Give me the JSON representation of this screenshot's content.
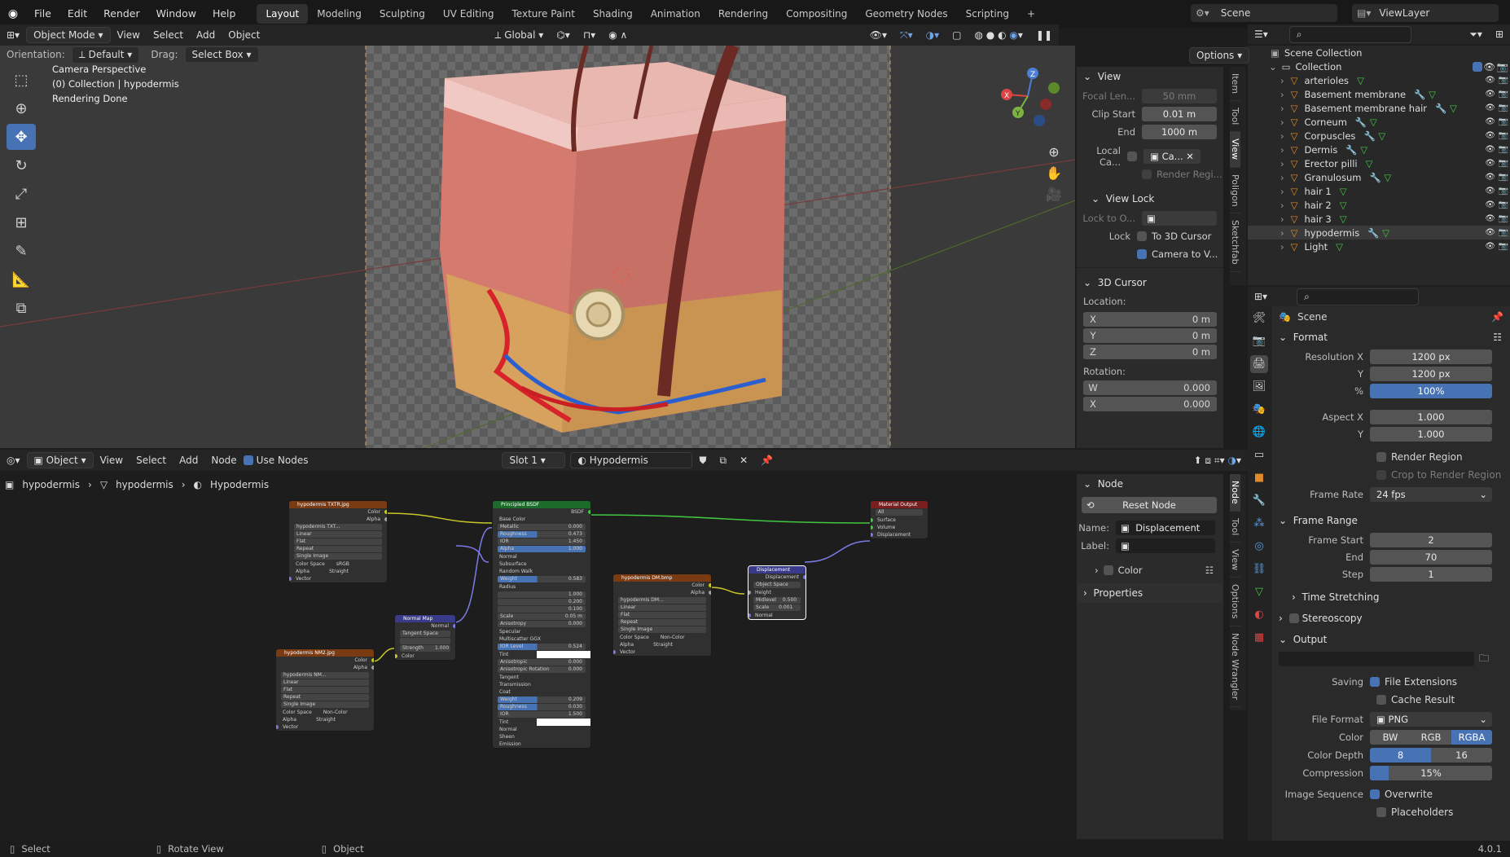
{
  "menu": [
    "File",
    "Edit",
    "Render",
    "Window",
    "Help"
  ],
  "workspaces": [
    "Layout",
    "Modeling",
    "Sculpting",
    "UV Editing",
    "Texture Paint",
    "Shading",
    "Animation",
    "Rendering",
    "Compositing",
    "Geometry Nodes",
    "Scripting",
    "+"
  ],
  "topright": {
    "scene": "Scene",
    "view_layer": "ViewLayer"
  },
  "viewport_header": {
    "mode": "Object Mode",
    "menus": [
      "View",
      "Select",
      "Add",
      "Object"
    ],
    "transform": "Global",
    "orientation_label": "Orientation:",
    "orientation": "Default",
    "drag_label": "Drag:",
    "drag": "Select Box",
    "options": "Options"
  },
  "viewport_overlay": {
    "line1": "Camera Perspective",
    "line2": "(0) Collection | hypodermis",
    "line3": "Rendering Done"
  },
  "npanel_view": {
    "section": "View",
    "focal_label": "Focal Len...",
    "focal": "50 mm",
    "clip_start_label": "Clip Start",
    "clip_start": "0.01 m",
    "clip_end_label": "End",
    "clip_end": "1000 m",
    "local_cam_label": "Local Ca...",
    "local_cam": "Ca...",
    "render_region": "Render Regi...",
    "view_lock": "View Lock",
    "lock_to_label": "Lock to O...",
    "lock_label": "Lock",
    "to_cursor": "To 3D Cursor",
    "cam_to_view": "Camera to V...",
    "cursor_section": "3D Cursor",
    "location_label": "Location:",
    "loc": [
      {
        "axis": "X",
        "val": "0 m"
      },
      {
        "axis": "Y",
        "val": "0 m"
      },
      {
        "axis": "Z",
        "val": "0 m"
      }
    ],
    "rotation_label": "Rotation:",
    "rot": [
      {
        "axis": "W",
        "val": "0.000"
      },
      {
        "axis": "X",
        "val": "0.000"
      }
    ]
  },
  "viewport_tabs": [
    "Item",
    "Tool",
    "View",
    "Poligon",
    "Sketchfab"
  ],
  "outliner": {
    "title": "Scene Collection",
    "collection": "Collection",
    "items": [
      "arterioles",
      "Basement membrane",
      "Basement membrane hair",
      "Corneum",
      "Corpuscles",
      "Dermis",
      "Erector pilli",
      "Granulosum",
      "hair 1",
      "hair 2",
      "hair 3",
      "hypodermis",
      "Light"
    ]
  },
  "node_header": {
    "mode": "Object",
    "menus": [
      "View",
      "Select",
      "Add",
      "Node"
    ],
    "use_nodes": "Use Nodes",
    "slot": "Slot 1",
    "material": "Hypodermis"
  },
  "breadcrumb": [
    "hypodermis",
    "hypodermis",
    "Hypodermis"
  ],
  "nodes": {
    "tex1": {
      "title": "hypodermis TXTR.jpg",
      "out1": "Color",
      "out2": "Alpha",
      "img": "hypodermis TXT...",
      "interp": "Linear",
      "proj": "Flat",
      "ext": "Repeat",
      "src": "Single Image",
      "cs_label": "Color Space",
      "cs": "sRGB",
      "alpha_label": "Alpha",
      "alpha": "Straight",
      "vec": "Vector"
    },
    "tex2": {
      "title": "hypodermis NM2.jpg",
      "out1": "Color",
      "out2": "Alpha",
      "img": "hypodermis NM...",
      "interp": "Linear",
      "proj": "Flat",
      "ext": "Repeat",
      "src": "Single Image",
      "cs_label": "Color Space",
      "cs": "Non-Color",
      "alpha_label": "Alpha",
      "alpha": "Straight",
      "vec": "Vector"
    },
    "nmap": {
      "title": "Normal Map",
      "out": "Normal",
      "space": "Tangent Space",
      "strength_label": "Strength",
      "strength": "1.000",
      "color": "Color"
    },
    "bsdf": {
      "title": "Principled BSDF",
      "out": "BSDF",
      "rows": [
        [
          "Base Color",
          ""
        ],
        [
          "Metallic",
          "0.000"
        ],
        [
          "Roughness",
          "0.473"
        ],
        [
          "IOR",
          "1.450"
        ],
        [
          "Alpha",
          "1.000"
        ],
        [
          "Normal",
          ""
        ],
        [
          "Subsurface",
          ""
        ],
        [
          "Random Walk",
          ""
        ],
        [
          "Weight",
          "0.583"
        ],
        [
          "Radius",
          ""
        ],
        [
          "",
          "1.000"
        ],
        [
          "",
          "0.200"
        ],
        [
          "",
          "0.100"
        ],
        [
          "Scale",
          "0.05 m"
        ],
        [
          "Anisotropy",
          "0.000"
        ],
        [
          "Specular",
          ""
        ],
        [
          "Multiscatter GGX",
          ""
        ],
        [
          "IOR Level",
          "0.524"
        ],
        [
          "Tint",
          ""
        ],
        [
          "Anisotropic",
          "0.000"
        ],
        [
          "Anisotropic Rotation",
          "0.000"
        ],
        [
          "Tangent",
          ""
        ],
        [
          "Transmission",
          ""
        ],
        [
          "Coat",
          ""
        ],
        [
          "Weight",
          "0.209"
        ],
        [
          "Roughness",
          "0.030"
        ],
        [
          "IOR",
          "1.500"
        ],
        [
          "Tint",
          ""
        ],
        [
          "Normal",
          ""
        ],
        [
          "Sheen",
          ""
        ],
        [
          "Emission",
          ""
        ]
      ]
    },
    "tex3": {
      "title": "hypodermis DM.bmp",
      "out1": "Color",
      "out2": "Alpha",
      "img": "hypodermis DM...",
      "interp": "Linear",
      "proj": "Flat",
      "ext": "Repeat",
      "src": "Single Image",
      "cs_label": "Color Space",
      "cs": "Non-Color",
      "alpha_label": "Alpha",
      "alpha": "Straight",
      "vec": "Vector"
    },
    "disp": {
      "title": "Displacement",
      "out": "Displacement",
      "space": "Object Space",
      "height": "Height",
      "mid_label": "Midlevel",
      "mid": "0.500",
      "scale_label": "Scale",
      "scale": "0.001",
      "normal": "Normal"
    },
    "out": {
      "title": "Material Output",
      "target": "All",
      "s1": "Surface",
      "s2": "Volume",
      "s3": "Displacement"
    }
  },
  "node_panel": {
    "section": "Node",
    "reset": "Reset Node",
    "name_label": "Name:",
    "name": "Displacement",
    "label_label": "Label:",
    "color": "Color",
    "properties": "Properties"
  },
  "node_tabs": [
    "Node",
    "Tool",
    "View",
    "Options",
    "Node Wrangler"
  ],
  "props": {
    "scene": "Scene",
    "format": "Format",
    "resx_label": "Resolution X",
    "resx": "1200 px",
    "resy_label": "Y",
    "resy": "1200 px",
    "pct_label": "%",
    "pct": "100%",
    "aspx_label": "Aspect X",
    "aspx": "1.000",
    "aspy_label": "Y",
    "aspy": "1.000",
    "render_region": "Render Region",
    "crop": "Crop to Render Region",
    "fps_label": "Frame Rate",
    "fps": "24 fps",
    "frame_range": "Frame Range",
    "fstart_label": "Frame Start",
    "fstart": "2",
    "fend_label": "End",
    "fend": "70",
    "fstep_label": "Step",
    "fstep": "1",
    "time_stretching": "Time Stretching",
    "stereoscopy": "Stereoscopy",
    "output": "Output",
    "saving_label": "Saving",
    "file_ext": "File Extensions",
    "cache": "Cache Result",
    "format_label": "File Format",
    "file_format": "PNG",
    "color_label": "Color",
    "bw": "BW",
    "rgb": "RGB",
    "rgba": "RGBA",
    "depth_label": "Color Depth",
    "d8": "8",
    "d16": "16",
    "comp_label": "Compression",
    "comp": "15%",
    "seq_label": "Image Sequence",
    "overwrite": "Overwrite",
    "placeholders": "Placeholders"
  },
  "status": {
    "select": "Select",
    "rotate": "Rotate View",
    "object": "Object",
    "version": "4.0.1"
  },
  "colors": {
    "accent": "#4772b3",
    "tex_header": "#7a3a12",
    "shader_header": "#1c6b2b",
    "vector_header": "#3a3a8a",
    "output_header": "#7a1f1f"
  }
}
